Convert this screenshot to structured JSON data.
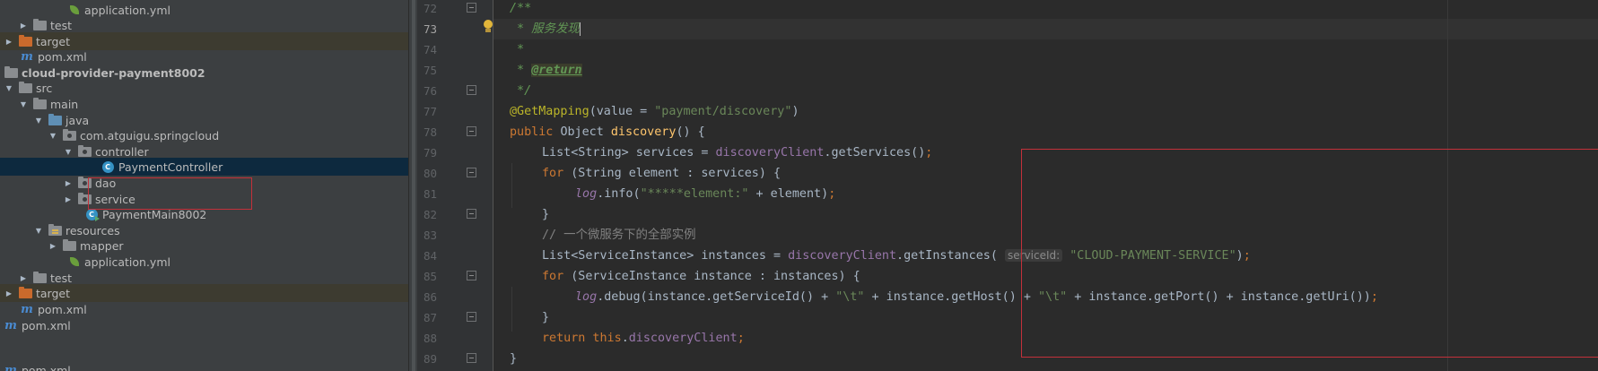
{
  "project_tree": {
    "rows": [
      {
        "label": "application.yml"
      },
      {
        "label": "test"
      },
      {
        "label": "target"
      },
      {
        "label": "pom.xml"
      },
      {
        "label": "cloud-provider-payment8002"
      },
      {
        "label": "src"
      },
      {
        "label": "main"
      },
      {
        "label": "java"
      },
      {
        "label": "com.atguigu.springcloud"
      },
      {
        "label": "controller"
      },
      {
        "label": "PaymentController"
      },
      {
        "label": "dao"
      },
      {
        "label": "service"
      },
      {
        "label": "PaymentMain8002"
      },
      {
        "label": "resources"
      },
      {
        "label": "mapper"
      },
      {
        "label": "application.yml"
      },
      {
        "label": "test"
      },
      {
        "label": "target"
      },
      {
        "label": "pom.xml"
      },
      {
        "label": "pom.xml"
      }
    ]
  },
  "editor": {
    "line_numbers": [
      "72",
      "73",
      "74",
      "75",
      "76",
      "77",
      "78",
      "79",
      "80",
      "81",
      "82",
      "83",
      "84",
      "85",
      "86",
      "87",
      "88",
      "89"
    ],
    "current_line": "73",
    "code": {
      "l72": "/**",
      "l73": " * 服务发现",
      "l74": " *",
      "l75_prefix": " * ",
      "l75_tag": "@return",
      "l76": " */",
      "l77_annotation": "@GetMapping",
      "l77_open": "(",
      "l77_param": "value",
      "l77_eq": " = ",
      "l77_str": "\"payment/discovery\"",
      "l77_close": ")",
      "l78_kw": "public ",
      "l78_type": "Object ",
      "l78_fn": "discovery",
      "l78_rest": "() {",
      "l79_type": "List<String> services = ",
      "l79_field": "discoveryClient",
      "l79_call": ".getServices()",
      "l79_semi": ";",
      "l80_kw": "for ",
      "l80_rest": "(String element : services) {",
      "l81_log": "log",
      "l81_call": ".info(",
      "l81_str": "\"*****element:\"",
      "l81_rest": " + element)",
      "l81_semi": ";",
      "l82": "}",
      "l83": "// 一个微服务下的全部实例",
      "l84_type": "List<ServiceInstance> instances = ",
      "l84_field": "discoveryClient",
      "l84_call": ".getInstances(",
      "l84_hint": "serviceId:",
      "l84_str": "\"CLOUD-PAYMENT-SERVICE\"",
      "l84_close": ")",
      "l84_semi": ";",
      "l85_kw": "for ",
      "l85_rest": "(ServiceInstance instance : instances) {",
      "l86_log": "log",
      "l86_a": ".debug(instance.getServiceId() + ",
      "l86_s1": "\"\\t\"",
      "l86_b": " + instance.getHost() + ",
      "l86_s2": "\"\\t\"",
      "l86_c": " + instance.getPort() + instance.getUri())",
      "l86_semi": ";",
      "l87": "}",
      "l88_kw": "return this",
      "l88_dot": ".",
      "l88_field": "discoveryClient",
      "l88_semi": ";",
      "l89": "}"
    }
  }
}
